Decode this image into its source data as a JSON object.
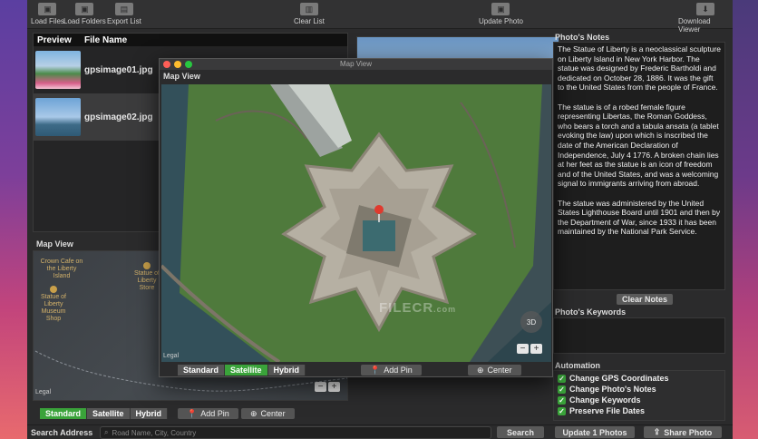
{
  "toolbar": {
    "load_files": "Load Files",
    "load_folders": "Load Folders",
    "export_list": "Export List",
    "clear_list": "Clear List",
    "update_photo": "Update Photo",
    "download_viewer": "Download Viewer"
  },
  "file_list": {
    "col_preview": "Preview",
    "col_file_name": "File Name",
    "rows": [
      {
        "name": "gpsimage01.jpg"
      },
      {
        "name": "gpsimage02.jpg"
      }
    ]
  },
  "map_view": {
    "title": "Map View",
    "pois": [
      "Crown Cafe on the Liberty Island",
      "Statue of Liberty Store",
      "Statue of Liberty Museum Shop"
    ],
    "legal": "Legal",
    "map_types": [
      "Standard",
      "Satellite",
      "Hybrid"
    ],
    "selected_map_type": "Standard",
    "add_pin": "Add Pin",
    "center": "Center",
    "zoom_out": "−",
    "zoom_in": "+"
  },
  "floating_map": {
    "window_title": "Map View",
    "label": "Map View",
    "map_types": [
      "Standard",
      "Satellite",
      "Hybrid"
    ],
    "selected_map_type": "Satellite",
    "add_pin": "Add Pin",
    "center": "Center",
    "compass": "3D",
    "zoom_out": "−",
    "zoom_in": "+",
    "legal": "Legal",
    "watermark": "FILECR",
    "watermark_suffix": ".com"
  },
  "notes": {
    "title": "Photo's Notes",
    "text": "The Statue of Liberty is a neoclassical sculpture on Liberty Island in New York Harbor. The statue was designed by Frederic Bartholdi and dedicated on October 28, 1886. It was the gift to the United States from the people of France.\n\nThe statue is of a robed female figure representing Libertas, the Roman Goddess, who bears a torch and a tabula ansata (a tablet evoking the law) upon which is inscribed the date of the American Declaration of Independence, July 4 1776. A broken chain lies at her feet as the statue is an icon of freedom and of the United States, and was a welcoming signal to immigrants arriving from abroad.\n\nThe statue was administered by the United States Lighthouse Board until 1901 and then by the Department of War, since 1933 it has been maintained by the National Park Service.",
    "clear_notes": "Clear Notes",
    "keywords_title": "Photo's Keywords",
    "automation_title": "Automation",
    "options": [
      "Change GPS Coordinates",
      "Change Photo's Notes",
      "Change Keywords",
      "Preserve File Dates"
    ]
  },
  "footer": {
    "search_label": "Search Address",
    "search_placeholder": "Road Name, City, Country",
    "search_button": "Search",
    "update_button": "Update 1 Photos",
    "share_button": "Share Photo"
  },
  "colors": {
    "accent_green": "#3aa33a",
    "pin_red": "#e03a2e"
  }
}
